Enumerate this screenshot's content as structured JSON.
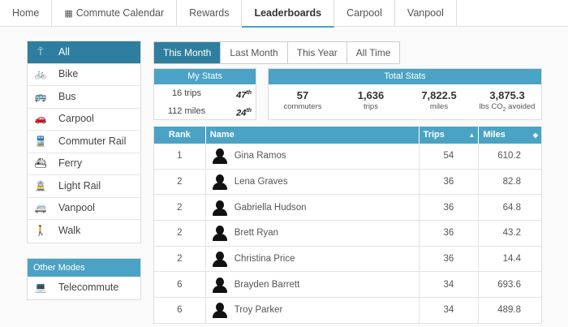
{
  "tabs": [
    {
      "label": "Home",
      "icon": ""
    },
    {
      "label": "Commute Calendar",
      "icon": "calendar-icon"
    },
    {
      "label": "Rewards",
      "icon": ""
    },
    {
      "label": "Leaderboards",
      "icon": ""
    },
    {
      "label": "Carpool",
      "icon": ""
    },
    {
      "label": "Vanpool",
      "icon": ""
    }
  ],
  "active_tab": "Leaderboards",
  "sidebar": {
    "items": [
      {
        "label": "All",
        "icon": "all-modes-icon",
        "glyph": "⍑",
        "active": true
      },
      {
        "label": "Bike",
        "icon": "bike-icon",
        "glyph": "🚲"
      },
      {
        "label": "Bus",
        "icon": "bus-icon",
        "glyph": "🚌"
      },
      {
        "label": "Carpool",
        "icon": "car-icon",
        "glyph": "🚗"
      },
      {
        "label": "Commuter Rail",
        "icon": "train-icon",
        "glyph": "🚆"
      },
      {
        "label": "Ferry",
        "icon": "ferry-icon",
        "glyph": "⛴"
      },
      {
        "label": "Light Rail",
        "icon": "light-rail-icon",
        "glyph": "🚊"
      },
      {
        "label": "Vanpool",
        "icon": "van-icon",
        "glyph": "🚐"
      },
      {
        "label": "Walk",
        "icon": "walk-icon",
        "glyph": "🚶"
      }
    ]
  },
  "other_modes": {
    "title": "Other Modes",
    "items": [
      {
        "label": "Telecommute",
        "icon": "laptop-icon",
        "glyph": "💻"
      }
    ]
  },
  "periods": [
    {
      "label": "This Month",
      "active": true
    },
    {
      "label": "Last Month"
    },
    {
      "label": "This Year"
    },
    {
      "label": "All Time"
    }
  ],
  "my_stats": {
    "title": "My Stats",
    "rows": [
      {
        "value": "16 trips",
        "rank": "47",
        "suffix": "th"
      },
      {
        "value": "112 miles",
        "rank": "24",
        "suffix": "th"
      }
    ]
  },
  "total_stats": {
    "title": "Total Stats",
    "items": [
      {
        "value": "57",
        "label": "commuters"
      },
      {
        "value": "1,636",
        "label": "trips"
      },
      {
        "value": "7,822.5",
        "label": "miles"
      },
      {
        "value": "3,875.3",
        "label_pre": "lbs CO",
        "label_sub": "2",
        "label_post": " avoided"
      }
    ]
  },
  "leaderboard": {
    "headers": {
      "rank": "Rank",
      "name": "Name",
      "trips": "Trips",
      "miles": "Miles"
    },
    "sort_trips": "▲",
    "sort_miles": "◆",
    "rows": [
      {
        "rank": "1",
        "name": "Gina Ramos",
        "trips": "54",
        "miles": "610.2"
      },
      {
        "rank": "2",
        "name": "Lena Graves",
        "trips": "36",
        "miles": "82.8"
      },
      {
        "rank": "2",
        "name": "Gabriella Hudson",
        "trips": "36",
        "miles": "64.8"
      },
      {
        "rank": "2",
        "name": "Brett Ryan",
        "trips": "36",
        "miles": "43.2"
      },
      {
        "rank": "2",
        "name": "Christina Price",
        "trips": "36",
        "miles": "14.4"
      },
      {
        "rank": "6",
        "name": "Brayden Barrett",
        "trips": "34",
        "miles": "693.6"
      },
      {
        "rank": "6",
        "name": "Troy Parker",
        "trips": "34",
        "miles": "489.8"
      }
    ]
  },
  "colors": {
    "accent": "#2e7f9f",
    "header": "#4aa3c4"
  }
}
